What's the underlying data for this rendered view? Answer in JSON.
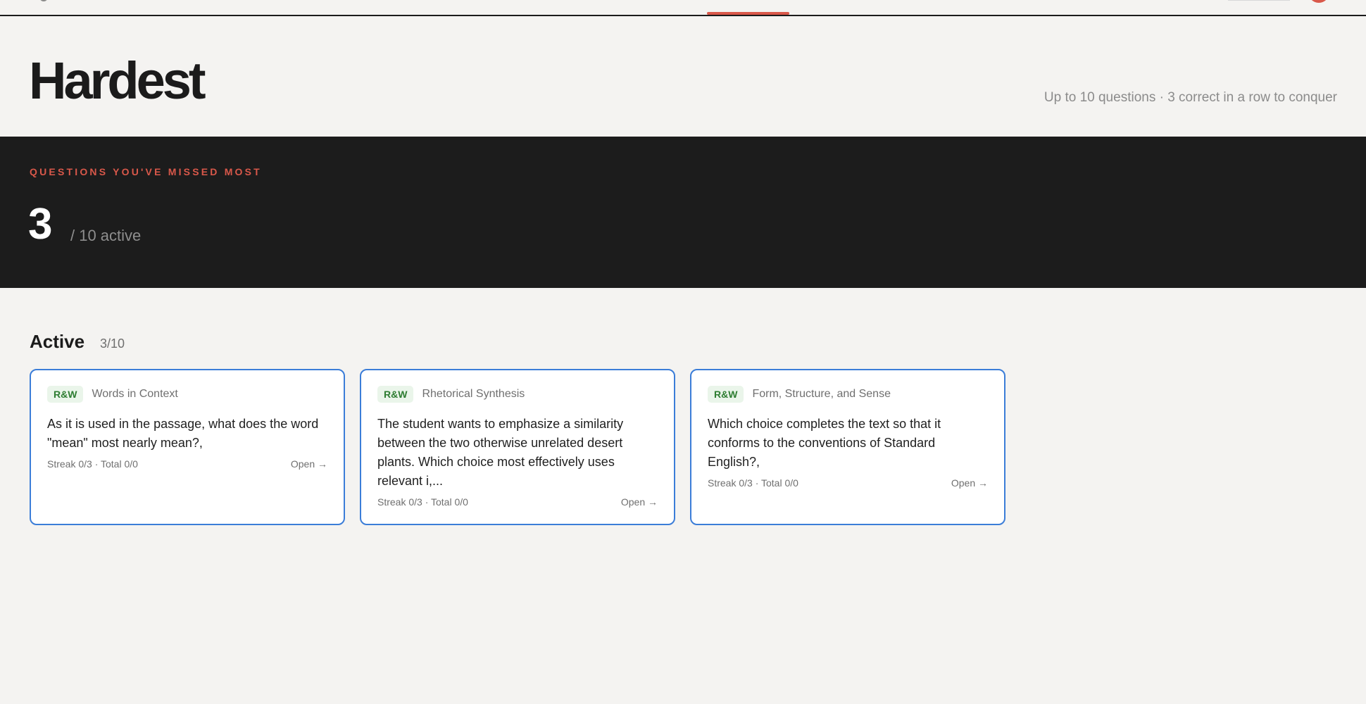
{
  "header": {
    "title": "Hardest",
    "subtitle": "Up to 10 questions · 3 correct in a row to conquer"
  },
  "hero": {
    "eyebrow": "QUESTIONS YOU'VE MISSED MOST",
    "count": "3",
    "count_suffix": "/ 10 active"
  },
  "active": {
    "title": "Active",
    "count": "3/10",
    "cards": [
      {
        "badge": "R&W",
        "category": "Words in Context",
        "text": "As it is used in the passage, what does the word \"mean\" most nearly mean?,",
        "stats": "Streak 0/3 · Total 0/0",
        "open_label": "Open →"
      },
      {
        "badge": "R&W",
        "category": "Rhetorical Synthesis",
        "text": "The student wants to emphasize a similarity between the two otherwise unrelated desert plants. Which choice most effectively uses relevant i,...",
        "stats": "Streak 0/3 · Total 0/0",
        "open_label": "Open →"
      },
      {
        "badge": "R&W",
        "category": "Form, Structure, and Sense",
        "text": "Which choice completes the text so that it conforms to the conventions of Standard English?,",
        "stats": "Streak 0/3 · Total 0/0",
        "open_label": "Open →"
      }
    ]
  },
  "colors": {
    "accent": "#d9584a",
    "card_border": "#3b7dd8",
    "badge_bg": "#eaf5ea",
    "badge_text": "#2e7d32",
    "band_bg": "#1c1c1c",
    "page_bg": "#f4f3f1"
  }
}
